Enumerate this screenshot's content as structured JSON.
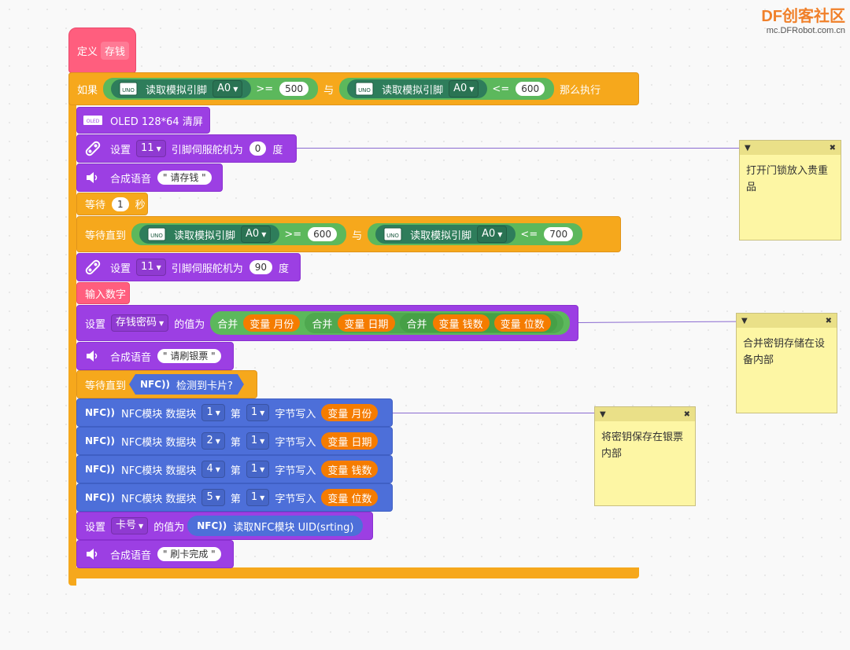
{
  "logo": {
    "brand": "DF创客社区",
    "url": "mc.DFRobot.com.cn"
  },
  "define": {
    "label": "定义",
    "name": "存钱"
  },
  "if_block": {
    "label": "如果",
    "then": "那么执行",
    "and": "与",
    "cond1": {
      "read": "读取模拟引脚",
      "pin": "A0",
      "op": ">=",
      "val": "500"
    },
    "cond2": {
      "read": "读取模拟引脚",
      "pin": "A0",
      "op": "<=",
      "val": "600"
    }
  },
  "oled_clear": {
    "label": "OLED 128*64 清屏",
    "icon": "OLED"
  },
  "servo1": {
    "set": "设置",
    "pin": "11",
    "text": "引脚伺服舵机为",
    "val": "0",
    "unit": "度"
  },
  "speech1": {
    "label": "合成语音",
    "text": "\" 请存钱 \""
  },
  "wait": {
    "label": "等待",
    "val": "1",
    "unit": "秒"
  },
  "wait_until1": {
    "label": "等待直到",
    "and": "与",
    "cond1": {
      "read": "读取模拟引脚",
      "pin": "A0",
      "op": ">=",
      "val": "600"
    },
    "cond2": {
      "read": "读取模拟引脚",
      "pin": "A0",
      "op": "<=",
      "val": "700"
    }
  },
  "servo2": {
    "set": "设置",
    "pin": "11",
    "text": "引脚伺服舵机为",
    "val": "90",
    "unit": "度"
  },
  "input_num": {
    "label": "输入数字"
  },
  "set_var": {
    "set": "设置",
    "var": "存钱密码",
    "value_of": "的值为",
    "join": "合并",
    "v1": "变量 月份",
    "v2": "变量 日期",
    "v3": "变量 钱数",
    "v4": "变量 位数"
  },
  "speech2": {
    "label": "合成语音",
    "text": "\" 请刷银票 \""
  },
  "wait_until2": {
    "label": "等待直到",
    "nfc": "NFC",
    "detect": "检测到卡片?"
  },
  "nfc_rows": [
    {
      "module": "NFC模块 数据块",
      "block": "1",
      "nth": "第",
      "byte": "1",
      "write": "字节写入",
      "var": "变量 月份"
    },
    {
      "module": "NFC模块 数据块",
      "block": "2",
      "nth": "第",
      "byte": "1",
      "write": "字节写入",
      "var": "变量 日期"
    },
    {
      "module": "NFC模块 数据块",
      "block": "4",
      "nth": "第",
      "byte": "1",
      "write": "字节写入",
      "var": "变量 钱数"
    },
    {
      "module": "NFC模块 数据块",
      "block": "5",
      "nth": "第",
      "byte": "1",
      "write": "字节写入",
      "var": "变量 位数"
    }
  ],
  "set_card": {
    "set": "设置",
    "var": "卡号",
    "value_of": "的值为",
    "nfc": "NFC",
    "read": "读取NFC模块 UID(srting)"
  },
  "speech3": {
    "label": "合成语音",
    "text": "\" 刷卡完成 \""
  },
  "notes": [
    {
      "text": "打开门锁放入贵重品"
    },
    {
      "text": "合并密钥存储在设备内部"
    },
    {
      "text": "将密钥保存在银票内部"
    }
  ],
  "colors": {
    "orange": "#f6a81c",
    "purple": "#9c3fe3",
    "blue": "#4d6fd9",
    "pink": "#ff5e7e",
    "green": "#5cb85c"
  }
}
